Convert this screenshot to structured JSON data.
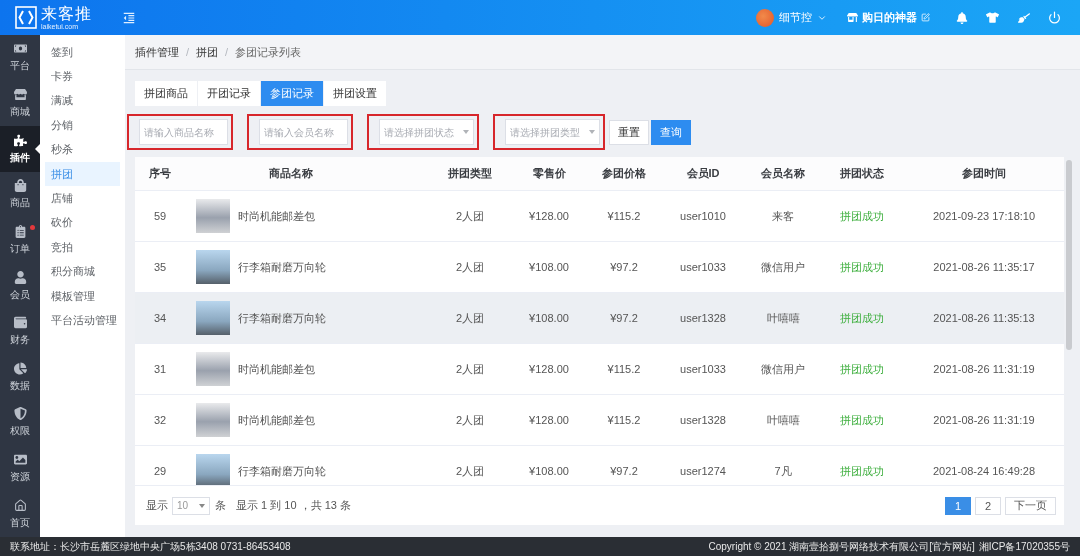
{
  "header": {
    "logo_title": "来客推",
    "logo_domain": "laiketui.com",
    "user_name": "细节控",
    "store_name": "购日的神器"
  },
  "nav": [
    {
      "label": "平台",
      "selected": false,
      "alert": false
    },
    {
      "label": "商城",
      "selected": false,
      "alert": false
    },
    {
      "label": "插件",
      "selected": true,
      "alert": false
    },
    {
      "label": "商品",
      "selected": false,
      "alert": false
    },
    {
      "label": "订单",
      "selected": false,
      "alert": true
    },
    {
      "label": "会员",
      "selected": false,
      "alert": false
    },
    {
      "label": "财务",
      "selected": false,
      "alert": false
    },
    {
      "label": "数据",
      "selected": false,
      "alert": false
    },
    {
      "label": "权限",
      "selected": false,
      "alert": false
    },
    {
      "label": "资源",
      "selected": false,
      "alert": false
    },
    {
      "label": "首页",
      "selected": false,
      "alert": false
    }
  ],
  "submenu": [
    {
      "label": "签到",
      "selected": false
    },
    {
      "label": "卡券",
      "selected": false
    },
    {
      "label": "满减",
      "selected": false
    },
    {
      "label": "分销",
      "selected": false
    },
    {
      "label": "秒杀",
      "selected": false
    },
    {
      "label": "拼团",
      "selected": true
    },
    {
      "label": "店铺",
      "selected": false
    },
    {
      "label": "砍价",
      "selected": false
    },
    {
      "label": "竞拍",
      "selected": false
    },
    {
      "label": "积分商城",
      "selected": false
    },
    {
      "label": "模板管理",
      "selected": false
    },
    {
      "label": "平台活动管理",
      "selected": false
    }
  ],
  "breadcrumb": {
    "separator": "/",
    "items": [
      "插件管理",
      "拼团",
      "参团记录列表"
    ]
  },
  "tabs": [
    {
      "label": "拼团商品",
      "selected": false
    },
    {
      "label": "开团记录",
      "selected": false
    },
    {
      "label": "参团记录",
      "selected": true
    },
    {
      "label": "拼团设置",
      "selected": false
    }
  ],
  "filters": [
    {
      "kind": "input",
      "placeholder": "请输入商品名称",
      "highlighted": true
    },
    {
      "kind": "input",
      "placeholder": "请输入会员名称",
      "highlighted": true
    },
    {
      "kind": "select",
      "placeholder": "请选择拼团状态",
      "highlighted": true
    },
    {
      "kind": "select",
      "placeholder": "请选择拼团类型",
      "highlighted": true
    }
  ],
  "filter_buttons": [
    {
      "kind": "default",
      "label": "重置"
    },
    {
      "kind": "primary",
      "label": "查询"
    }
  ],
  "table": {
    "columns": [
      "序号",
      "商品名称",
      "拼团类型",
      "零售价",
      "参团价格",
      "会员ID",
      "会员名称",
      "拼团状态",
      "参团时间"
    ],
    "rows": [
      {
        "no": "59",
        "product": "时尚机能邮差包",
        "group_type": "2人团",
        "retail_price": "¥128.00",
        "group_price": "¥115.2",
        "member_id": "user1010",
        "member_name": "来客",
        "status": "拼团成功",
        "joined_at": "2021-09-23 17:18:10",
        "hovered": false
      },
      {
        "no": "35",
        "product": "行李箱耐磨万向轮",
        "group_type": "2人团",
        "retail_price": "¥108.00",
        "group_price": "¥97.2",
        "member_id": "user1033",
        "member_name": "微信用户",
        "status": "拼团成功",
        "joined_at": "2021-08-26 11:35:17",
        "hovered": false
      },
      {
        "no": "34",
        "product": "行李箱耐磨万向轮",
        "group_type": "2人团",
        "retail_price": "¥108.00",
        "group_price": "¥97.2",
        "member_id": "user1328",
        "member_name": "叶嘻嘻",
        "status": "拼团成功",
        "joined_at": "2021-08-26 11:35:13",
        "hovered": true
      },
      {
        "no": "31",
        "product": "时尚机能邮差包",
        "group_type": "2人团",
        "retail_price": "¥128.00",
        "group_price": "¥115.2",
        "member_id": "user1033",
        "member_name": "微信用户",
        "status": "拼团成功",
        "joined_at": "2021-08-26 11:31:19",
        "hovered": false
      },
      {
        "no": "32",
        "product": "时尚机能邮差包",
        "group_type": "2人团",
        "retail_price": "¥128.00",
        "group_price": "¥115.2",
        "member_id": "user1328",
        "member_name": "叶嘻嘻",
        "status": "拼团成功",
        "joined_at": "2021-08-26 11:31:19",
        "hovered": false
      },
      {
        "no": "29",
        "product": "行李箱耐磨万向轮",
        "group_type": "2人团",
        "retail_price": "¥108.00",
        "group_price": "¥97.2",
        "member_id": "user1274",
        "member_name": "7凡",
        "status": "拼团成功",
        "joined_at": "2021-08-24 16:49:28",
        "hovered": false
      }
    ]
  },
  "pagination": {
    "show_label": "显示",
    "page_size": "10",
    "unit_label": "条",
    "summary": "显示 1 到 10 ，共 13 条",
    "pages": [
      {
        "label": "1",
        "selected": true
      },
      {
        "label": "2",
        "selected": false
      }
    ],
    "next_label": "下一页"
  },
  "footer": {
    "address": "联系地址：长沙市岳麓区绿地中央广场5栋3408 0731-86453408",
    "copyright": "Copyright © 2021 湖南壹拾捌号网络技术有限公司",
    "site_link": "[官方网站]",
    "icp": "湘ICP备17020355号"
  }
}
